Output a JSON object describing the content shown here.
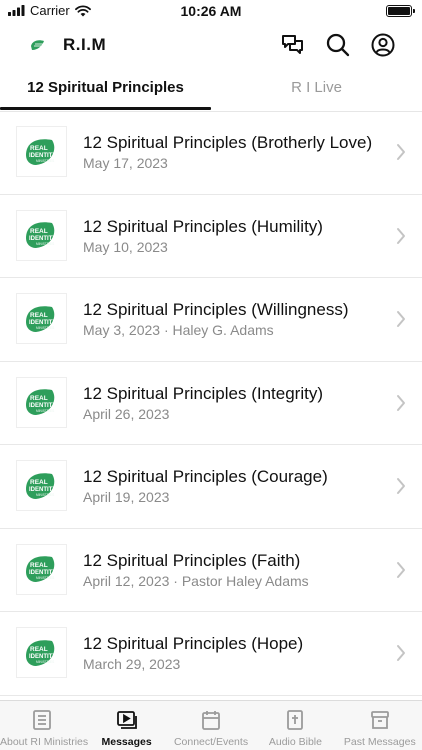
{
  "status_bar": {
    "carrier": "Carrier",
    "time": "10:26 AM",
    "icons": [
      "wifi-icon",
      "battery-icon"
    ]
  },
  "header": {
    "title": "R.I.M",
    "icons": [
      "chat-icon",
      "search-icon",
      "profile-icon"
    ]
  },
  "tabs": [
    {
      "label": "12 Spiritual Principles",
      "active": true
    },
    {
      "label": "R I Live",
      "active": false
    }
  ],
  "messages": [
    {
      "title": "12 Spiritual Principles (Brotherly Love)",
      "subtitle": "May 17, 2023"
    },
    {
      "title": "12 Spiritual Principles (Humility)",
      "subtitle": "May 10, 2023"
    },
    {
      "title": "12 Spiritual Principles (Willingness)",
      "subtitle": "May 3, 2023 · Haley G. Adams"
    },
    {
      "title": "12 Spiritual Principles (Integrity)",
      "subtitle": "April 26, 2023"
    },
    {
      "title": "12 Spiritual Principles (Courage)",
      "subtitle": "April 19, 2023"
    },
    {
      "title": "12 Spiritual Principles (Faith)",
      "subtitle": "April 12, 2023 · Pastor Haley Adams"
    },
    {
      "title": "12 Spiritual Principles (Hope)",
      "subtitle": "March 29, 2023"
    }
  ],
  "thumbnail_logo": {
    "line1": "REAL",
    "line2": "IDENTITY",
    "line3": "MINISTRIES",
    "color": "#2e9e5b"
  },
  "bottom_nav": [
    {
      "label": "About RI Ministries",
      "icon": "book-icon",
      "active": false
    },
    {
      "label": "Messages",
      "icon": "video-icon",
      "active": true
    },
    {
      "label": "Connect/Events",
      "icon": "calendar-icon",
      "active": false
    },
    {
      "label": "Audio Bible",
      "icon": "bible-icon",
      "active": false
    },
    {
      "label": "Past Messages",
      "icon": "archive-icon",
      "active": false
    }
  ]
}
